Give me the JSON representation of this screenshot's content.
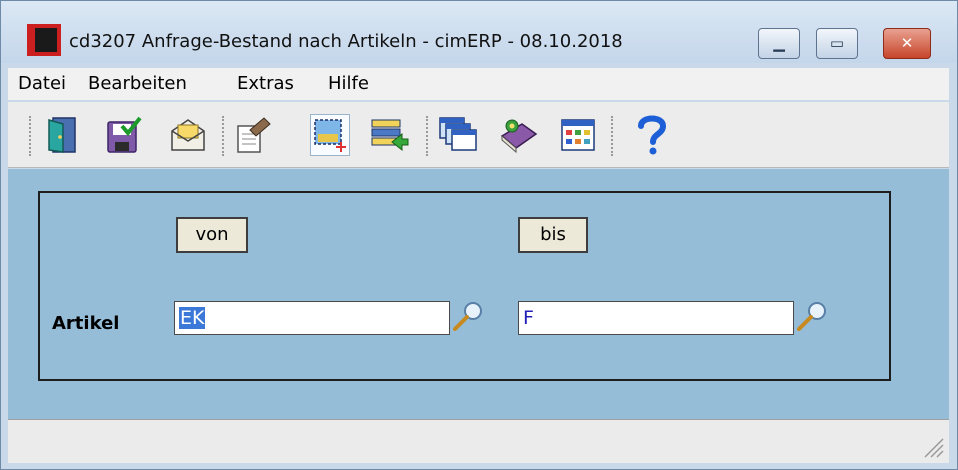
{
  "window": {
    "title": "cd3207 Anfrage-Bestand nach Artikeln - cimERP - 08.10.2018",
    "minimize_glyph": "▁",
    "maximize_glyph": "▭",
    "close_glyph": "✕"
  },
  "menu": {
    "items": [
      "Datei",
      "Bearbeiten",
      "Extras",
      "Hilfe"
    ]
  },
  "toolbar": {
    "icons": [
      "exit-door-icon",
      "save-check-icon",
      "mail-envelope-icon",
      "edit-form-icon",
      "new-selection-icon",
      "list-import-icon",
      "windows-stack-icon",
      "book-help-icon",
      "table-grid-icon",
      "help-question-icon"
    ]
  },
  "form": {
    "von_label": "von",
    "bis_label": "bis",
    "field_label": "Artikel",
    "von_value": "EK",
    "bis_value": "F"
  },
  "colors": {
    "content_bg": "#96bdd8",
    "selection": "#3b78d8",
    "logo_red": "#cc1f1f"
  }
}
